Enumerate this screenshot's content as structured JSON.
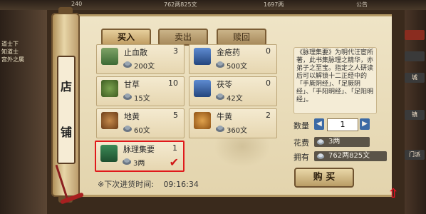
{
  "top_bar": {
    "left": "240",
    "middle": "762两825文",
    "right": "1697两",
    "notice": "公告"
  },
  "left_text": [
    "道士下",
    "知道士",
    "宫外之属"
  ],
  "right_tabs": [
    "",
    "",
    "城",
    "镇",
    "门派"
  ],
  "shop_sign": [
    "店",
    "铺"
  ],
  "tabs": [
    {
      "label": "买入",
      "active": true
    },
    {
      "label": "卖出",
      "active": false
    },
    {
      "label": "赎回",
      "active": false
    }
  ],
  "items": [
    {
      "name": "止血散",
      "qty": "3",
      "price": "200文",
      "icon": "green-medicine-bottle",
      "selected": false
    },
    {
      "name": "金疮药",
      "qty": "0",
      "price": "500文",
      "icon": "blue-medicine-bottle",
      "selected": false
    },
    {
      "name": "甘草",
      "qty": "10",
      "price": "15文",
      "icon": "licorice-herb",
      "selected": false
    },
    {
      "name": "茯苓",
      "qty": "0",
      "price": "42文",
      "icon": "blue-medicine-bottle",
      "selected": false
    },
    {
      "name": "地黄",
      "qty": "5",
      "price": "60文",
      "icon": "rehmannia-root",
      "selected": false
    },
    {
      "name": "牛黄",
      "qty": "2",
      "price": "360文",
      "icon": "bezoar",
      "selected": false
    },
    {
      "name": "脉理集要",
      "qty": "1",
      "price": "3两",
      "icon": "green-book",
      "selected": true
    }
  ],
  "restock": {
    "label": "※下次进货时间:",
    "time": "09:16:34"
  },
  "description": "《脉理集要》为明代汪宦所著，此书集脉理之精华，亦弟子之至宝。指定之人研读后可以解锁十二正经中的「手厥阴经」、「足厥阴经」、「手阳明经」、「足阳明经」。",
  "purchase": {
    "quantity_label": "数量",
    "quantity": "1",
    "cost_label": "花费",
    "cost": "3两",
    "owned_label": "拥有",
    "owned": "762两825文",
    "buy_label": "购 买"
  },
  "colors": {
    "selected_border": "#e0191b",
    "checkmark": "#d01717"
  }
}
